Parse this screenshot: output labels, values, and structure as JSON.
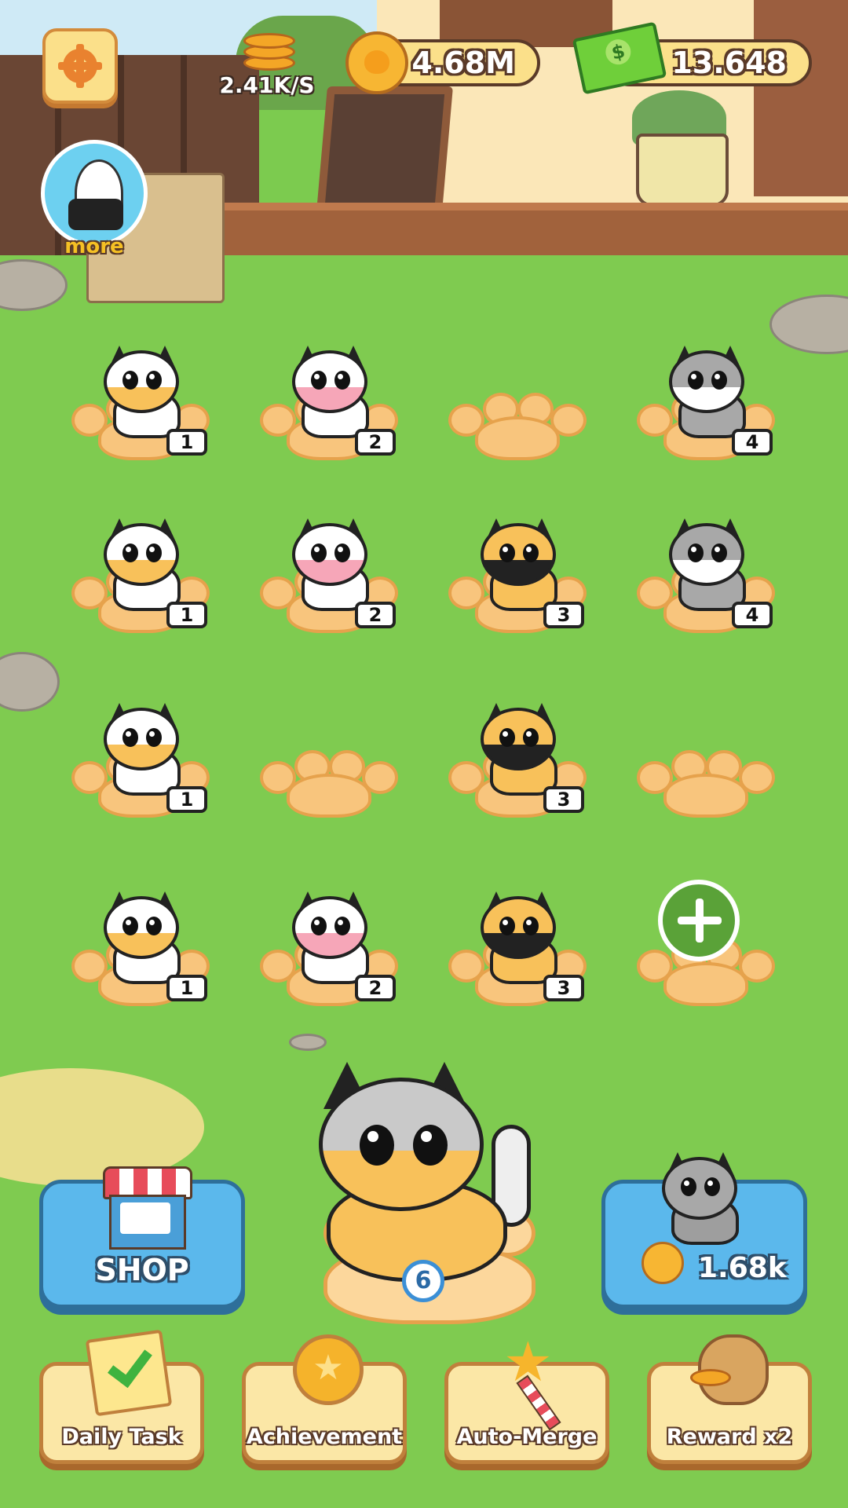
{
  "hud": {
    "coin_rate": "2.41K/S",
    "coins": "4.68M",
    "cash": "$ 13.648",
    "more_label": "more",
    "icons": {
      "settings": "gear-icon",
      "coin_rate": "coin-stack-icon",
      "coins": "cat-coin-icon",
      "cash": "cash-icon"
    }
  },
  "grid": {
    "rows": [
      [
        {
          "level": "1",
          "occupied": true
        },
        {
          "level": "2",
          "occupied": true
        },
        {
          "level": "",
          "occupied": false
        },
        {
          "level": "4",
          "occupied": true
        }
      ],
      [
        {
          "level": "1",
          "occupied": true
        },
        {
          "level": "2",
          "occupied": true
        },
        {
          "level": "3",
          "occupied": true
        },
        {
          "level": "4",
          "occupied": true
        }
      ],
      [
        {
          "level": "1",
          "occupied": true
        },
        {
          "level": "",
          "occupied": false
        },
        {
          "level": "3",
          "occupied": true
        },
        {
          "level": "",
          "occupied": false
        }
      ],
      [
        {
          "level": "1",
          "occupied": true
        },
        {
          "level": "2",
          "occupied": true
        },
        {
          "level": "3",
          "occupied": true
        },
        {
          "level": "",
          "occupied": false,
          "add_slot": true
        }
      ]
    ]
  },
  "featured_cat": {
    "level": "6"
  },
  "shop": {
    "label": "SHOP"
  },
  "buy_cat": {
    "price": "1.68k"
  },
  "actions": [
    {
      "label": "Daily Task",
      "icon": "checklist-icon"
    },
    {
      "label": "Achievement",
      "icon": "medal-icon"
    },
    {
      "label": "Auto-Merge",
      "icon": "magic-wand-icon"
    },
    {
      "label": "Reward x2",
      "icon": "coin-bag-icon"
    }
  ],
  "colors": {
    "grass": "#7fcb50",
    "button_blue": "#5bb8ec",
    "button_cream": "#fbe7a6",
    "paw_orange": "#f8c57d"
  }
}
